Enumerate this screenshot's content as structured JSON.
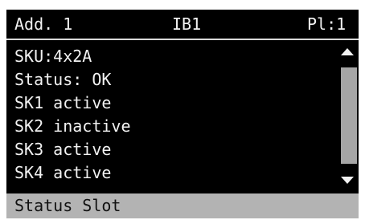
{
  "header": {
    "left_label": "Add. 1",
    "center_label": "IB1",
    "right_label": "Pl:1"
  },
  "status_list": {
    "items": [
      {
        "label": "SKU:4x2A"
      },
      {
        "label": "Status: OK"
      },
      {
        "label": "SK1 active"
      },
      {
        "label": "SK2 inactive"
      },
      {
        "label": "SK3 active"
      },
      {
        "label": "SK4 active"
      }
    ]
  },
  "footer": {
    "label": "Status Slot"
  },
  "icons": {
    "scroll_up": "triangle-up-icon",
    "scroll_down": "triangle-down-icon"
  },
  "colors": {
    "screen_background": "#000000",
    "text": "#f2f2f2",
    "footer_background": "#b3b3b3",
    "scrollbar_thumb": "#a6a6a6"
  }
}
